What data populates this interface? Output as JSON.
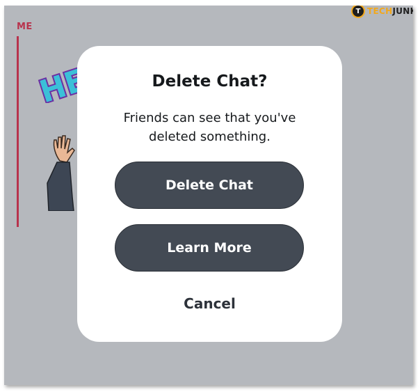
{
  "chat": {
    "sender_label": "ME"
  },
  "brand": {
    "badge_letter": "T",
    "name_part1": "TECH",
    "name_part2": "JUNKIE"
  },
  "dialog": {
    "title": "Delete Chat?",
    "message": "Friends can see that you've deleted something.",
    "buttons": {
      "delete": "Delete Chat",
      "learn_more": "Learn More",
      "cancel": "Cancel"
    }
  },
  "colors": {
    "background": "#b5b8bd",
    "sender_accent": "#b8334d",
    "button_fill": "#434a54",
    "dialog_bg": "#ffffff",
    "brand_accent": "#f2a81d"
  },
  "icons": {
    "sticker": "hello-sticker-icon",
    "avatar": "bitmoji-waving-icon",
    "brand_logo": "techjunkie-logo-icon"
  }
}
